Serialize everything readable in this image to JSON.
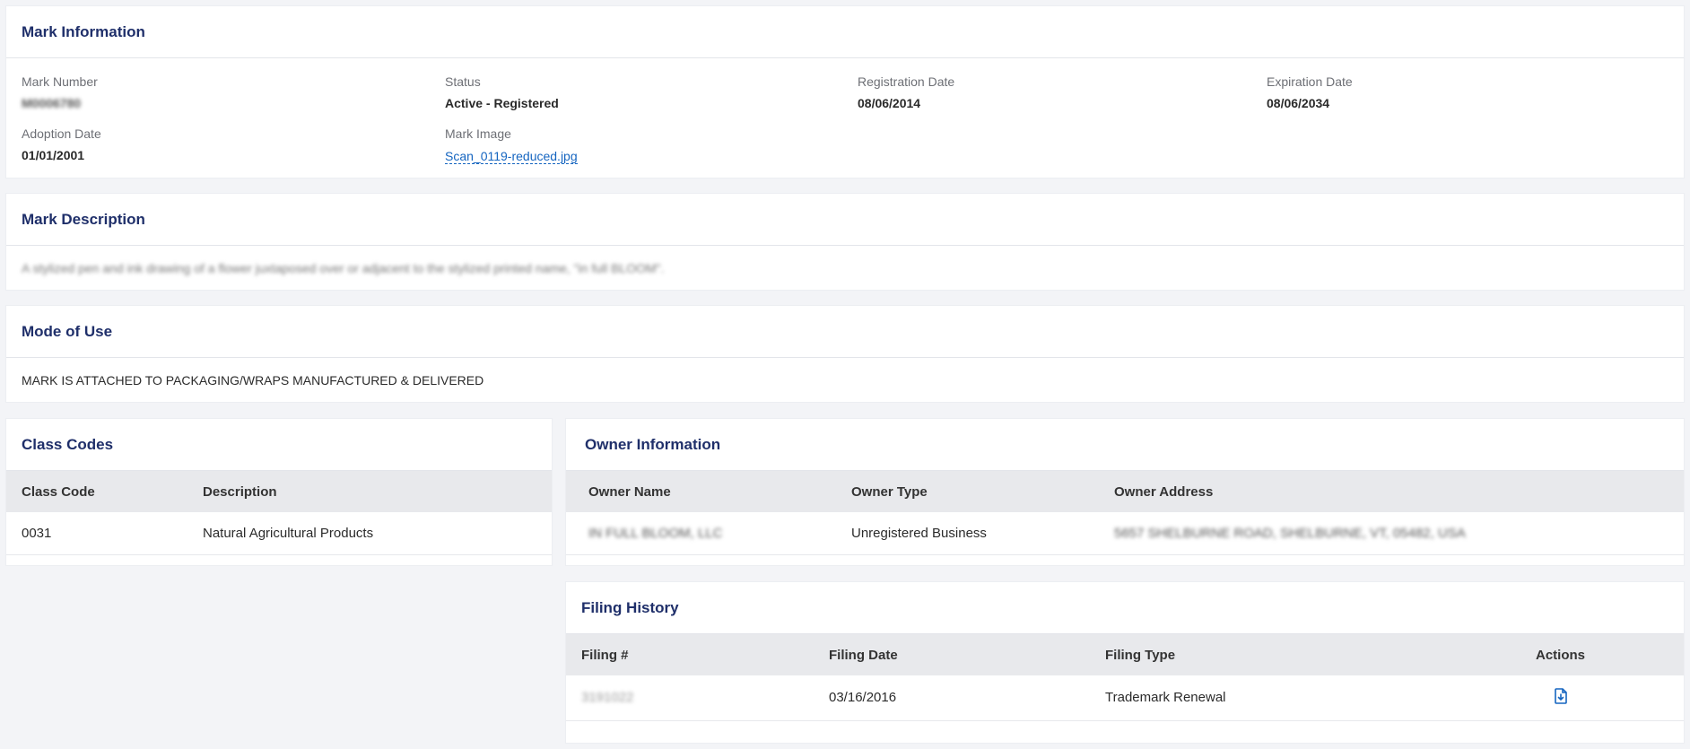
{
  "mark_information": {
    "title": "Mark Information",
    "mark_number_label": "Mark Number",
    "mark_number_value": "M0006780",
    "status_label": "Status",
    "status_value": "Active - Registered",
    "registration_date_label": "Registration Date",
    "registration_date_value": "08/06/2014",
    "expiration_date_label": "Expiration Date",
    "expiration_date_value": "08/06/2034",
    "adoption_date_label": "Adoption Date",
    "adoption_date_value": "01/01/2001",
    "mark_image_label": "Mark Image",
    "mark_image_value": "Scan_0119-reduced.jpg"
  },
  "mark_description": {
    "title": "Mark Description",
    "text": "A stylized pen and ink drawing of a flower juxtaposed over or adjacent to the stylized printed name, \"in full BLOOM\"."
  },
  "mode_of_use": {
    "title": "Mode of Use",
    "text": "MARK IS ATTACHED TO PACKAGING/WRAPS MANUFACTURED & DELIVERED"
  },
  "class_codes": {
    "title": "Class Codes",
    "columns": [
      "Class Code",
      "Description"
    ],
    "rows": [
      {
        "code": "0031",
        "description": "Natural Agricultural Products"
      }
    ]
  },
  "owner_information": {
    "title": "Owner Information",
    "columns": [
      "Owner Name",
      "Owner Type",
      "Owner Address"
    ],
    "rows": [
      {
        "name": "IN FULL BLOOM, LLC",
        "type": "Unregistered Business",
        "address": "5657 SHELBURNE ROAD, SHELBURNE, VT, 05482, USA"
      }
    ]
  },
  "filing_history": {
    "title": "Filing History",
    "columns": [
      "Filing #",
      "Filing Date",
      "Filing Type",
      "Actions"
    ],
    "rows": [
      {
        "number": "3191022",
        "date": "03/16/2016",
        "type": "Trademark Renewal",
        "action_icon": "download-file-icon"
      }
    ]
  },
  "colors": {
    "heading": "#1f2f6a",
    "link": "#1565c0",
    "table_header_bg": "#e8e9ec"
  }
}
